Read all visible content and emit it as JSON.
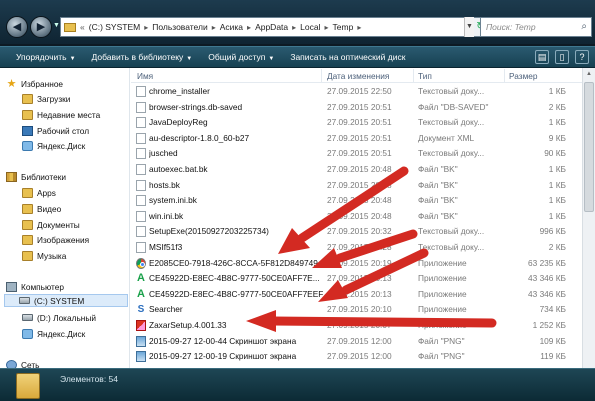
{
  "address": {
    "lead": "«",
    "segments": [
      "(C:) SYSTEM",
      "Пользователи",
      "Асика",
      "AppData",
      "Local",
      "Temp"
    ],
    "search_placeholder": "Поиск: Temp"
  },
  "toolbar": {
    "organize": "Упорядочить",
    "add_to_library": "Добавить в библиотеку",
    "share": "Общий доступ",
    "burn": "Записать на оптический диск"
  },
  "sidebar": {
    "favorites": "Избранное",
    "downloads": "Загрузки",
    "recent": "Недавние места",
    "desktop": "Рабочий стол",
    "yandex_disk": "Яндекс.Диск",
    "libraries": "Библиотеки",
    "apps": "Apps",
    "video": "Видео",
    "documents": "Документы",
    "images": "Изображения",
    "music": "Музыка",
    "computer": "Компьютер",
    "drive_c": "(C:) SYSTEM",
    "drive_d": "(D:) Локальный",
    "yandex_disk_2": "Яндекс.Диск",
    "network": "Сеть"
  },
  "columns": {
    "name": "Имя",
    "date": "Дата изменения",
    "type": "Тип",
    "size": "Размер"
  },
  "files": [
    {
      "name": "chrome_installer",
      "date": "27.09.2015 22:50",
      "type": "Текстовый доку...",
      "size": "1 КБ",
      "icon": "doc"
    },
    {
      "name": "browser-strings.db-saved",
      "date": "27.09.2015 20:51",
      "type": "Файл \"DB-SAVED\"",
      "size": "2 КБ",
      "icon": "doc"
    },
    {
      "name": "JavaDeployReg",
      "date": "27.09.2015 20:51",
      "type": "Текстовый доку...",
      "size": "1 КБ",
      "icon": "doc"
    },
    {
      "name": "au-descriptor-1.8.0_60-b27",
      "date": "27.09.2015 20:51",
      "type": "Документ XML",
      "size": "9 КБ",
      "icon": "doc"
    },
    {
      "name": "jusched",
      "date": "27.09.2015 20:51",
      "type": "Текстовый доку...",
      "size": "90 КБ",
      "icon": "doc"
    },
    {
      "name": "autoexec.bat.bk",
      "date": "27.09.2015 20:48",
      "type": "Файл \"BK\"",
      "size": "1 КБ",
      "icon": "doc"
    },
    {
      "name": "hosts.bk",
      "date": "27.09.2015 20:48",
      "type": "Файл \"BK\"",
      "size": "1 КБ",
      "icon": "doc"
    },
    {
      "name": "system.ini.bk",
      "date": "27.09.2015 20:48",
      "type": "Файл \"BK\"",
      "size": "1 КБ",
      "icon": "doc"
    },
    {
      "name": "win.ini.bk",
      "date": "27.09.2015 20:48",
      "type": "Файл \"BK\"",
      "size": "1 КБ",
      "icon": "doc"
    },
    {
      "name": "SetupExe(20150927203225734)",
      "date": "27.09.2015 20:32",
      "type": "Текстовый доку...",
      "size": "996 КБ",
      "icon": "doc"
    },
    {
      "name": "MSIf51f3",
      "date": "27.09.2015 20:28",
      "type": "Текстовый доку...",
      "size": "2 КБ",
      "icon": "doc"
    },
    {
      "name": "E2085CE0-7918-426C-8CCA-5F812D849749",
      "date": "27.09.2015 20:19",
      "type": "Приложение",
      "size": "63 235 КБ",
      "icon": "chrome"
    },
    {
      "name": "CE45922D-E8EC-4B8C-9777-50CE0AFF7E...",
      "date": "27.09.2015 20:13",
      "type": "Приложение",
      "size": "43 346 КБ",
      "icon": "a"
    },
    {
      "name": "CE45922D-E8EC-4B8C-9777-50CE0AFF7EEF",
      "date": "27.09.2015 20:13",
      "type": "Приложение",
      "size": "43 346 КБ",
      "icon": "a"
    },
    {
      "name": "Searcher",
      "date": "27.09.2015 20:10",
      "type": "Приложение",
      "size": "734 КБ",
      "icon": "search"
    },
    {
      "name": "ZaxarSetup.4.001.33",
      "date": "27.09.2015 20:07",
      "type": "Приложение",
      "size": "1 252 КБ",
      "icon": "zaxar"
    },
    {
      "name": "2015-09-27 12-00-44 Скриншот экрана",
      "date": "27.09.2015 12:00",
      "type": "Файл \"PNG\"",
      "size": "109 КБ",
      "icon": "png"
    },
    {
      "name": "2015-09-27 12-00-19 Скриншот экрана",
      "date": "27.09.2015 12:00",
      "type": "Файл \"PNG\"",
      "size": "119 КБ",
      "icon": "png"
    }
  ],
  "status": {
    "count": "Элементов: 54"
  }
}
